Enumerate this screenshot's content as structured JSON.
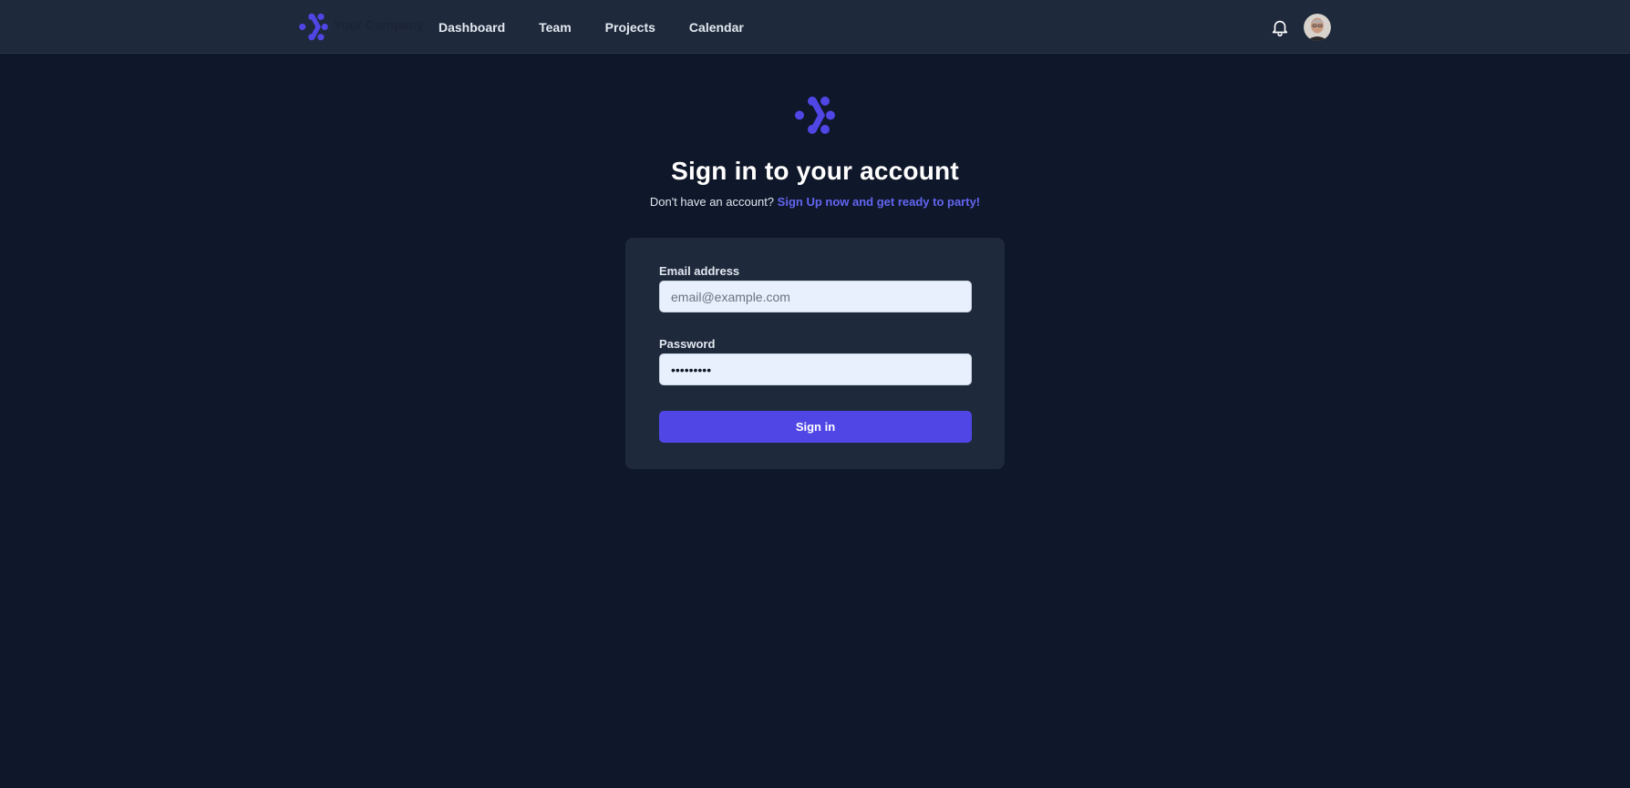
{
  "colors": {
    "background": "#0f172a",
    "topbar": "#1e293b",
    "card": "#1e293b",
    "accent": "#4f46e5",
    "link": "#6366f1",
    "input_bg": "#e8f0fe"
  },
  "header": {
    "logo_icon": "brand-logo-icon",
    "brand_name": "Your Company",
    "nav": [
      {
        "label": "Dashboard"
      },
      {
        "label": "Team"
      },
      {
        "label": "Projects"
      },
      {
        "label": "Calendar"
      }
    ],
    "notification_icon": "bell-icon",
    "avatar_icon": "user-avatar"
  },
  "signin": {
    "logo_icon": "brand-logo-icon",
    "title": "Sign in to your account",
    "subtitle_prefix": "Don't have an account?",
    "subtitle_link": "Sign Up now and get ready to party!",
    "email_label": "Email address",
    "email_placeholder": "email@example.com",
    "email_value": "",
    "password_label": "Password",
    "password_value": "password1",
    "submit_label": "Sign in"
  }
}
